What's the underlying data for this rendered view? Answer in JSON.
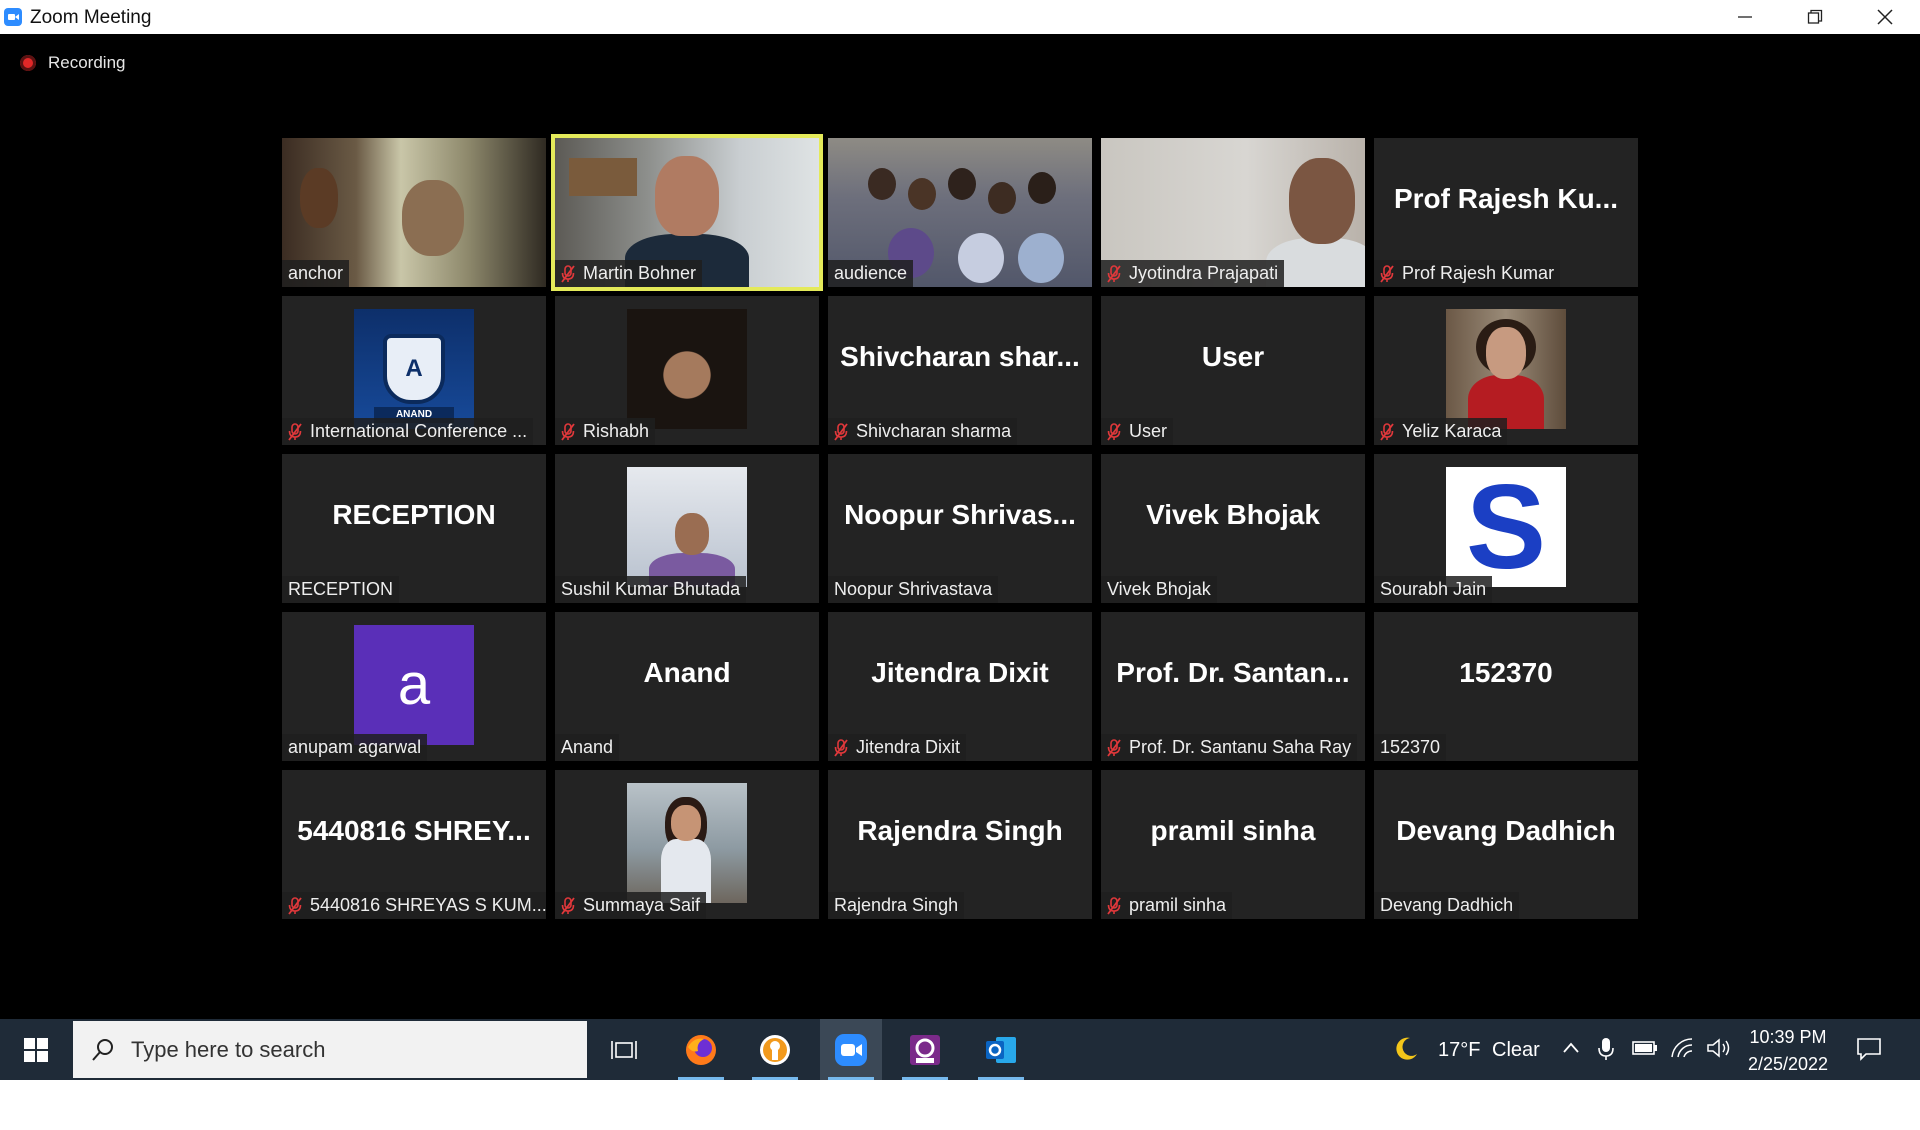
{
  "window": {
    "title": "Zoom Meeting",
    "minimize_icon": "minimize-icon",
    "restore_icon": "restore-icon",
    "close_icon": "close-icon"
  },
  "meeting": {
    "recording_label": "Recording",
    "tiles": [
      {
        "type": "video",
        "video": "anchor",
        "nameplate": "anchor",
        "muted": false
      },
      {
        "type": "video",
        "video": "martin",
        "nameplate": "Martin Bohner",
        "muted": true,
        "active": true
      },
      {
        "type": "video",
        "video": "audience",
        "nameplate": "audience",
        "muted": false
      },
      {
        "type": "video",
        "video": "jyotindra",
        "nameplate": "Jyotindra Prajapati",
        "muted": true
      },
      {
        "type": "name",
        "big": "Prof Rajesh Ku...",
        "nameplate": "Prof Rajesh Kumar",
        "muted": true
      },
      {
        "type": "thumb",
        "thumb": "anand-logo",
        "nameplate": "International Conference ...",
        "muted": true,
        "logo_text": "A",
        "logo_ribbon": "ANAND"
      },
      {
        "type": "thumb",
        "thumb": "rishabh",
        "nameplate": "Rishabh",
        "muted": true
      },
      {
        "type": "name",
        "big": "Shivcharan  shar...",
        "nameplate": "Shivcharan sharma",
        "muted": true
      },
      {
        "type": "name",
        "big": "User",
        "nameplate": "User",
        "muted": true
      },
      {
        "type": "thumb",
        "thumb": "yeliz",
        "nameplate": "Yeliz Karaca",
        "muted": true
      },
      {
        "type": "name",
        "big": "RECEPTION",
        "nameplate": "RECEPTION",
        "muted": false
      },
      {
        "type": "thumb",
        "thumb": "sushil",
        "nameplate": "Sushil Kumar Bhutada",
        "muted": false
      },
      {
        "type": "name",
        "big": "Noopur  Shrivas...",
        "nameplate": "Noopur Shrivastava",
        "muted": false
      },
      {
        "type": "name",
        "big": "Vivek Bhojak",
        "nameplate": "Vivek Bhojak",
        "muted": false
      },
      {
        "type": "thumb",
        "thumb": "s-letter",
        "nameplate": "Sourabh Jain",
        "muted": false,
        "letter": "S"
      },
      {
        "type": "thumb",
        "thumb": "a-letter",
        "nameplate": "anupam agarwal",
        "muted": false,
        "letter": "a"
      },
      {
        "type": "name",
        "big": "Anand",
        "nameplate": "Anand",
        "muted": false
      },
      {
        "type": "name",
        "big": "Jitendra  Dixit",
        "nameplate": "Jitendra  Dixit",
        "muted": true
      },
      {
        "type": "name",
        "big": "Prof. Dr. Santan...",
        "nameplate": "Prof. Dr. Santanu Saha Ray",
        "muted": true
      },
      {
        "type": "name",
        "big": "152370",
        "nameplate": "152370",
        "muted": false
      },
      {
        "type": "name",
        "big": "5440816  SHREY...",
        "nameplate": "5440816 SHREYAS S KUM...",
        "muted": true
      },
      {
        "type": "thumb",
        "thumb": "summaya",
        "nameplate": "Summaya Saif",
        "muted": true
      },
      {
        "type": "name",
        "big": "Rajendra Singh",
        "nameplate": "Rajendra Singh",
        "muted": false
      },
      {
        "type": "name",
        "big": "pramil sinha",
        "nameplate": "pramil sinha",
        "muted": true
      },
      {
        "type": "name",
        "big": "Devang Dadhich",
        "nameplate": "Devang Dadhich",
        "muted": false
      }
    ]
  },
  "taskbar": {
    "search_placeholder": "Type here to search",
    "apps": [
      {
        "name": "task-view-icon",
        "running": false
      },
      {
        "name": "firefox-icon",
        "running": true
      },
      {
        "name": "app-circle-icon",
        "running": true
      },
      {
        "name": "zoom-icon",
        "running": true,
        "active": true
      },
      {
        "name": "pdf-app-icon",
        "running": true
      },
      {
        "name": "outlook-icon",
        "running": true
      }
    ],
    "weather": {
      "temp": "17°F",
      "condition": "Clear",
      "icon": "moon-icon"
    },
    "clock": {
      "time": "10:39 PM",
      "date": "2/25/2022"
    }
  },
  "colors": {
    "meeting_bg": "#000000",
    "tile_bg": "#232323",
    "active_speaker": "#e4ea5a",
    "muted_red": "#e0383b",
    "taskbar_bg": "#1f2b38",
    "zoom_blue": "#2d8cff"
  }
}
